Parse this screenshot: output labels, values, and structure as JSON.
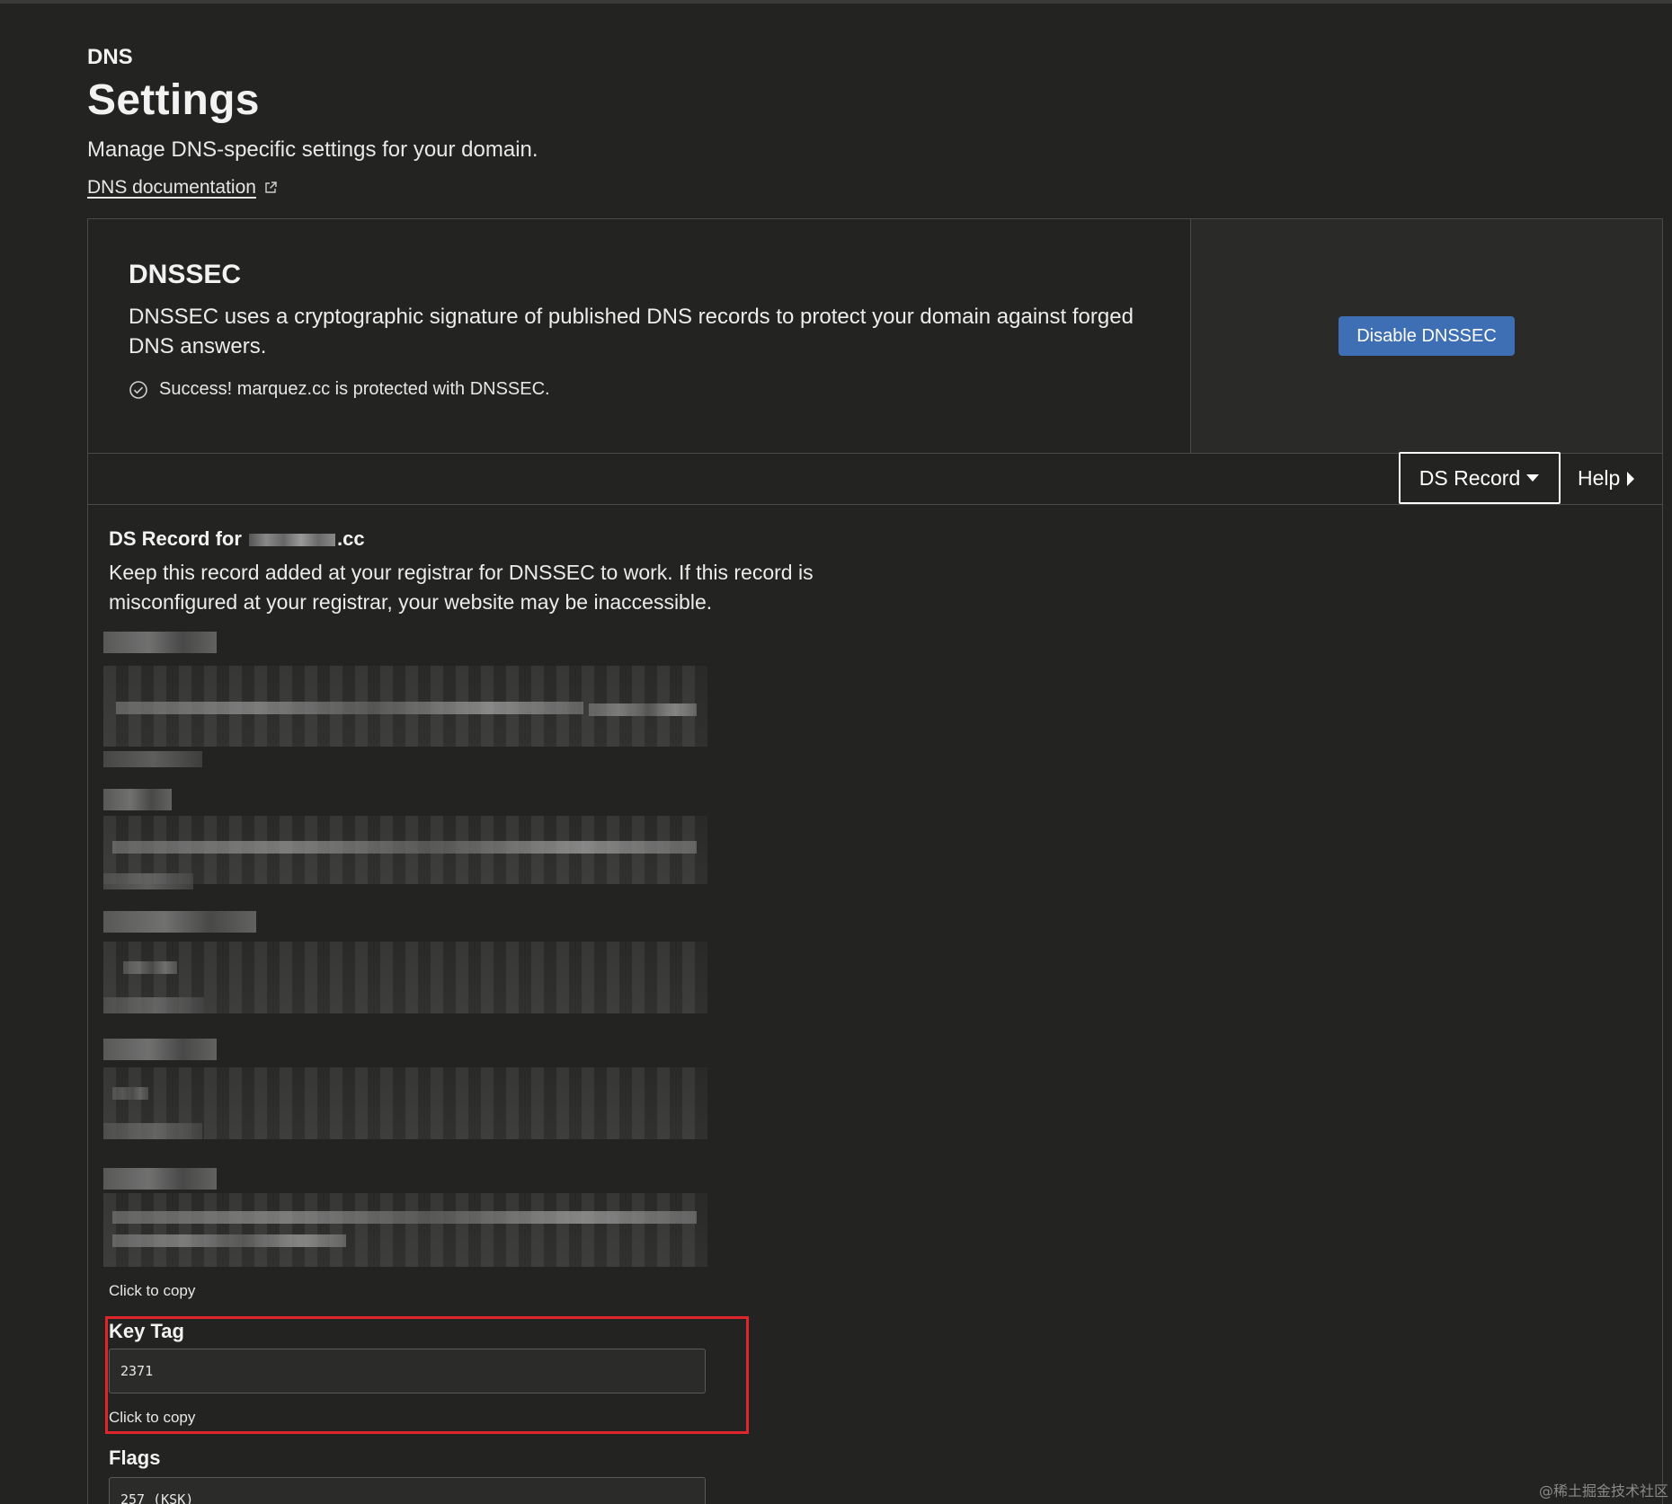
{
  "header": {
    "eyebrow": "DNS",
    "title": "Settings",
    "subtitle": "Manage DNS-specific settings for your domain.",
    "doc_link": "DNS documentation"
  },
  "dnssec": {
    "title": "DNSSEC",
    "description": "DNSSEC uses a cryptographic signature of published DNS records to protect your domain against forged DNS answers.",
    "status_text": "Success! marquez.cc is protected with DNSSEC.",
    "disable_button": "Disable DNSSEC"
  },
  "tabs": {
    "ds_record": "DS Record",
    "help": "Help"
  },
  "ds_record": {
    "heading_prefix": "DS Record for",
    "heading_suffix": ".cc",
    "description": "Keep this record added at your registrar for DNSSEC to work. If this record is misconfigured at your registrar, your website may be inaccessible.",
    "copy_hint": "Click to copy"
  },
  "fields": {
    "key_tag_label": "Key Tag",
    "key_tag_value": "2371",
    "key_tag_copy": "Click to copy",
    "flags_label": "Flags",
    "flags_value": "257 (KSK)"
  },
  "watermark": "@稀土掘金技术社区"
}
